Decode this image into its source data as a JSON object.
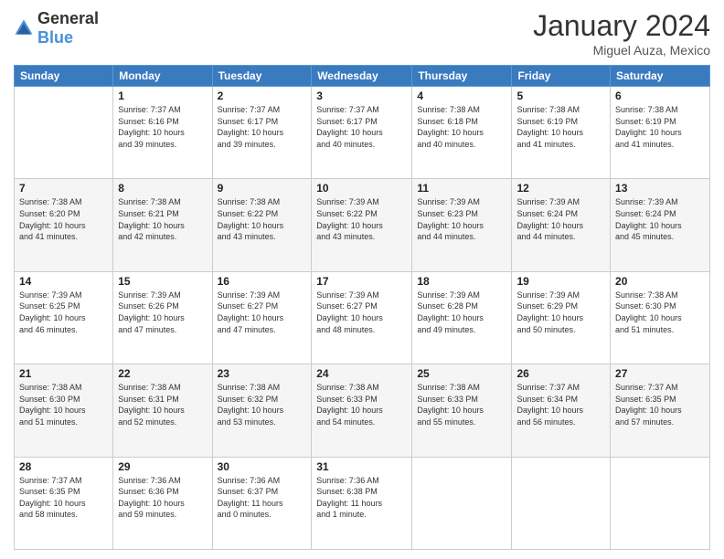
{
  "header": {
    "logo_general": "General",
    "logo_blue": "Blue",
    "month_year": "January 2024",
    "location": "Miguel Auza, Mexico"
  },
  "days_of_week": [
    "Sunday",
    "Monday",
    "Tuesday",
    "Wednesday",
    "Thursday",
    "Friday",
    "Saturday"
  ],
  "weeks": [
    [
      {
        "day": "",
        "info": ""
      },
      {
        "day": "1",
        "info": "Sunrise: 7:37 AM\nSunset: 6:16 PM\nDaylight: 10 hours\nand 39 minutes."
      },
      {
        "day": "2",
        "info": "Sunrise: 7:37 AM\nSunset: 6:17 PM\nDaylight: 10 hours\nand 39 minutes."
      },
      {
        "day": "3",
        "info": "Sunrise: 7:37 AM\nSunset: 6:17 PM\nDaylight: 10 hours\nand 40 minutes."
      },
      {
        "day": "4",
        "info": "Sunrise: 7:38 AM\nSunset: 6:18 PM\nDaylight: 10 hours\nand 40 minutes."
      },
      {
        "day": "5",
        "info": "Sunrise: 7:38 AM\nSunset: 6:19 PM\nDaylight: 10 hours\nand 41 minutes."
      },
      {
        "day": "6",
        "info": "Sunrise: 7:38 AM\nSunset: 6:19 PM\nDaylight: 10 hours\nand 41 minutes."
      }
    ],
    [
      {
        "day": "7",
        "info": "Sunrise: 7:38 AM\nSunset: 6:20 PM\nDaylight: 10 hours\nand 41 minutes."
      },
      {
        "day": "8",
        "info": "Sunrise: 7:38 AM\nSunset: 6:21 PM\nDaylight: 10 hours\nand 42 minutes."
      },
      {
        "day": "9",
        "info": "Sunrise: 7:38 AM\nSunset: 6:22 PM\nDaylight: 10 hours\nand 43 minutes."
      },
      {
        "day": "10",
        "info": "Sunrise: 7:39 AM\nSunset: 6:22 PM\nDaylight: 10 hours\nand 43 minutes."
      },
      {
        "day": "11",
        "info": "Sunrise: 7:39 AM\nSunset: 6:23 PM\nDaylight: 10 hours\nand 44 minutes."
      },
      {
        "day": "12",
        "info": "Sunrise: 7:39 AM\nSunset: 6:24 PM\nDaylight: 10 hours\nand 44 minutes."
      },
      {
        "day": "13",
        "info": "Sunrise: 7:39 AM\nSunset: 6:24 PM\nDaylight: 10 hours\nand 45 minutes."
      }
    ],
    [
      {
        "day": "14",
        "info": "Sunrise: 7:39 AM\nSunset: 6:25 PM\nDaylight: 10 hours\nand 46 minutes."
      },
      {
        "day": "15",
        "info": "Sunrise: 7:39 AM\nSunset: 6:26 PM\nDaylight: 10 hours\nand 47 minutes."
      },
      {
        "day": "16",
        "info": "Sunrise: 7:39 AM\nSunset: 6:27 PM\nDaylight: 10 hours\nand 47 minutes."
      },
      {
        "day": "17",
        "info": "Sunrise: 7:39 AM\nSunset: 6:27 PM\nDaylight: 10 hours\nand 48 minutes."
      },
      {
        "day": "18",
        "info": "Sunrise: 7:39 AM\nSunset: 6:28 PM\nDaylight: 10 hours\nand 49 minutes."
      },
      {
        "day": "19",
        "info": "Sunrise: 7:39 AM\nSunset: 6:29 PM\nDaylight: 10 hours\nand 50 minutes."
      },
      {
        "day": "20",
        "info": "Sunrise: 7:38 AM\nSunset: 6:30 PM\nDaylight: 10 hours\nand 51 minutes."
      }
    ],
    [
      {
        "day": "21",
        "info": "Sunrise: 7:38 AM\nSunset: 6:30 PM\nDaylight: 10 hours\nand 51 minutes."
      },
      {
        "day": "22",
        "info": "Sunrise: 7:38 AM\nSunset: 6:31 PM\nDaylight: 10 hours\nand 52 minutes."
      },
      {
        "day": "23",
        "info": "Sunrise: 7:38 AM\nSunset: 6:32 PM\nDaylight: 10 hours\nand 53 minutes."
      },
      {
        "day": "24",
        "info": "Sunrise: 7:38 AM\nSunset: 6:33 PM\nDaylight: 10 hours\nand 54 minutes."
      },
      {
        "day": "25",
        "info": "Sunrise: 7:38 AM\nSunset: 6:33 PM\nDaylight: 10 hours\nand 55 minutes."
      },
      {
        "day": "26",
        "info": "Sunrise: 7:37 AM\nSunset: 6:34 PM\nDaylight: 10 hours\nand 56 minutes."
      },
      {
        "day": "27",
        "info": "Sunrise: 7:37 AM\nSunset: 6:35 PM\nDaylight: 10 hours\nand 57 minutes."
      }
    ],
    [
      {
        "day": "28",
        "info": "Sunrise: 7:37 AM\nSunset: 6:35 PM\nDaylight: 10 hours\nand 58 minutes."
      },
      {
        "day": "29",
        "info": "Sunrise: 7:36 AM\nSunset: 6:36 PM\nDaylight: 10 hours\nand 59 minutes."
      },
      {
        "day": "30",
        "info": "Sunrise: 7:36 AM\nSunset: 6:37 PM\nDaylight: 11 hours\nand 0 minutes."
      },
      {
        "day": "31",
        "info": "Sunrise: 7:36 AM\nSunset: 6:38 PM\nDaylight: 11 hours\nand 1 minute."
      },
      {
        "day": "",
        "info": ""
      },
      {
        "day": "",
        "info": ""
      },
      {
        "day": "",
        "info": ""
      }
    ]
  ]
}
